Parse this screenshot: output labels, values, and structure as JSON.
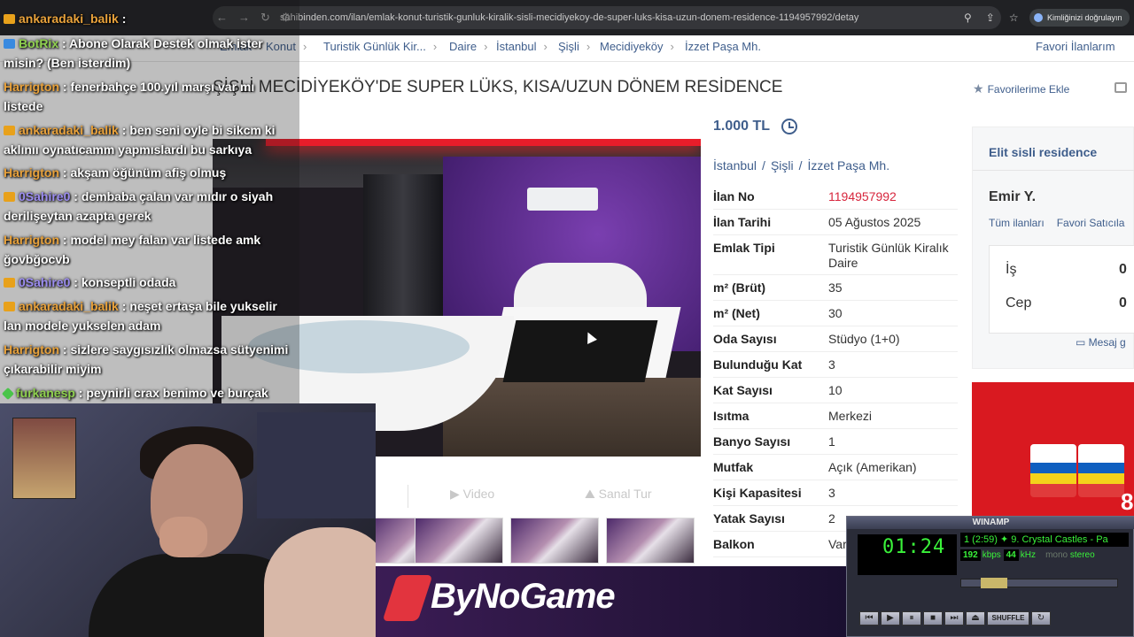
{
  "browser": {
    "url": "sahibinden.com/ilan/emlak-konut-turistik-gunluk-kiralik-sisli-mecidiyekoy-de-super-luks-kisa-uzun-donem-residence-1194957992/detay",
    "verify_label": "Kimliğinizi doğrulayın"
  },
  "breadcrumb": {
    "items": [
      "Emlak",
      "Konut",
      "Turistik Günlük Kir...",
      "Daire",
      "İstanbul",
      "Şişli",
      "Mecidiyeköy",
      "İzzet Paşa Mh."
    ],
    "favorites_label": "Favori İlanlarım"
  },
  "listing": {
    "title": "ŞİŞLİ MECİDİYEKÖY'DE SUPER LÜKS, KISA/UZUN DÖNEM RESİDENCE",
    "fav_add_label": "Favorilerime Ekle",
    "price": "1.000 TL",
    "location": [
      "İstanbul",
      "/",
      "Şişli",
      "/",
      "İzzet Paşa Mh."
    ],
    "video_label": "Video",
    "virtual_tour_label": "Sanal Tur",
    "details": [
      {
        "key": "İlan No",
        "value": "1194957992"
      },
      {
        "key": "İlan Tarihi",
        "value": "05 Ağustos 2025"
      },
      {
        "key": "Emlak Tipi",
        "value": "Turistik Günlük Kiralık Daire"
      },
      {
        "key": "m² (Brüt)",
        "value": "35"
      },
      {
        "key": "m² (Net)",
        "value": "30"
      },
      {
        "key": "Oda Sayısı",
        "value": "Stüdyo (1+0)"
      },
      {
        "key": "Bulunduğu Kat",
        "value": "3"
      },
      {
        "key": "Kat Sayısı",
        "value": "10"
      },
      {
        "key": "Isıtma",
        "value": "Merkezi"
      },
      {
        "key": "Banyo Sayısı",
        "value": "1"
      },
      {
        "key": "Mutfak",
        "value": "Açık (Amerikan)"
      },
      {
        "key": "Kişi Kapasitesi",
        "value": "3"
      },
      {
        "key": "Yatak Sayısı",
        "value": "2"
      },
      {
        "key": "Balkon",
        "value": "Var"
      }
    ]
  },
  "seller": {
    "store": "Elit sisli residence",
    "person": "Emir Y.",
    "all_listings": "Tüm ilanları",
    "favorite_seller": "Favori Satıcıla",
    "phone_work_label": "İş",
    "phone_work_value": "0",
    "phone_mobile_label": "Cep",
    "phone_mobile_value": "0",
    "message_label": "Mesaj g"
  },
  "chat": {
    "messages": [
      {
        "user": "ankaradaki_balik",
        "color": "#e9a23b",
        "badge": "crown",
        "text": ""
      },
      {
        "user": "BotRix",
        "color": "#8fd14f",
        "badge": "x",
        "text": "Abone Olarak Destek olmak ister misin? (Ben isterdim)"
      },
      {
        "user": "Harrigton",
        "color": "#e9a23b",
        "badge": "",
        "text": "fenerbahçe 100.yıl marşı var mı listede"
      },
      {
        "user": "ankaradaki_balik",
        "color": "#e9a23b",
        "badge": "crown",
        "text": "ben seni oyle bi sikcm ki aklınıı oynatıcamm yapmıslardı bu sarkıya"
      },
      {
        "user": "Harrigton",
        "color": "#e9a23b",
        "badge": "",
        "text": "akşam öğünüm afiş olmuş"
      },
      {
        "user": "0Sahire0",
        "color": "#9b8cf0",
        "badge": "crown",
        "text": "dembaba çalan var mıdır o siyah derilişeytan azapta gerek"
      },
      {
        "user": "Harrigton",
        "color": "#e9a23b",
        "badge": "",
        "text": "model mey falan var listede amk ğovbğocvb"
      },
      {
        "user": "0Sahire0",
        "color": "#9b8cf0",
        "badge": "crown",
        "text": "konseptli odada"
      },
      {
        "user": "ankaradaki_balik",
        "color": "#e9a23b",
        "badge": "crown",
        "text": "neşet ertaşa bile yukselir lan modele yukselen adam"
      },
      {
        "user": "Harrigton",
        "color": "#e9a23b",
        "badge": "",
        "text": "sizlere saygısızlık olmazsa sütyenimi çıkarabilir miyim"
      },
      {
        "user": "furkanesp",
        "color": "#8fd14f",
        "badge": "diamond",
        "text": "peynirli crax benimo ve burçak"
      }
    ]
  },
  "banner": {
    "brand": "ByNoGame"
  },
  "winamp": {
    "title": "WINAMP",
    "time": "01:24",
    "song": "1 (2:59) ✦ 9. Crystal Castles - Pa",
    "kbps": "192",
    "khz": "44",
    "kbps_label": "kbps",
    "khz_label": "kHz",
    "mono_label": "mono",
    "stereo_label": "stereo",
    "shuffle_label": "SHUFFLE"
  }
}
